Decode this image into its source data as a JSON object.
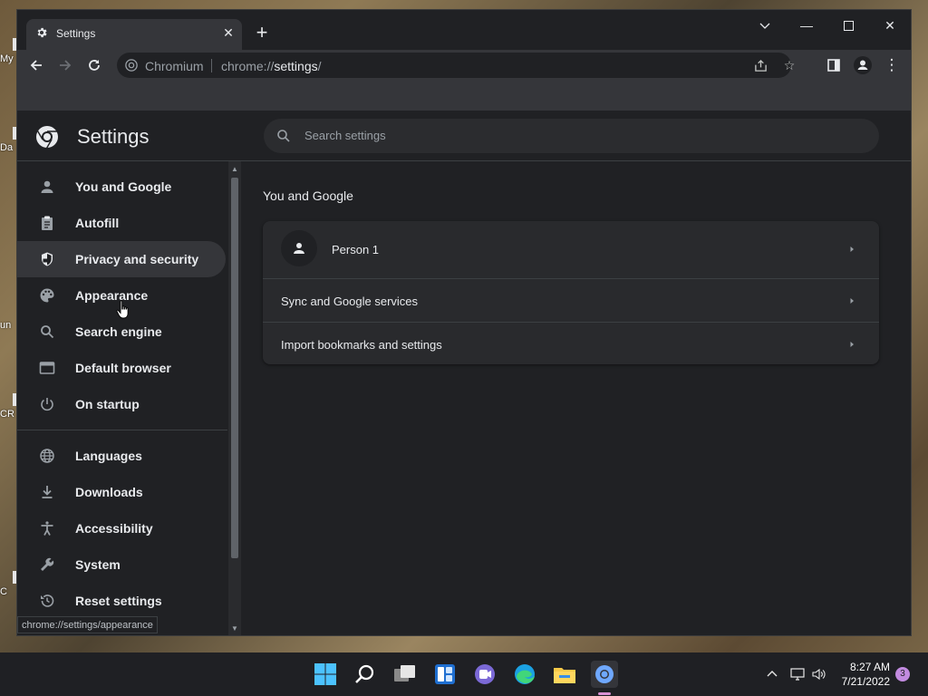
{
  "desktop": {
    "labels": [
      "My",
      "Da",
      "un",
      "CR",
      "C"
    ]
  },
  "browser": {
    "tab": {
      "title": "Settings"
    },
    "omnibox": {
      "site_label": "Chromium",
      "url_scheme": "chrome://",
      "url_path": "settings",
      "url_rest": "/"
    }
  },
  "settings": {
    "title": "Settings",
    "search_placeholder": "Search settings",
    "nav": [
      {
        "label": "You and Google",
        "icon": "person-icon"
      },
      {
        "label": "Autofill",
        "icon": "clipboard-icon"
      },
      {
        "label": "Privacy and security",
        "icon": "shield-icon",
        "active": true
      },
      {
        "label": "Appearance",
        "icon": "palette-icon"
      },
      {
        "label": "Search engine",
        "icon": "search-icon"
      },
      {
        "label": "Default browser",
        "icon": "browser-icon"
      },
      {
        "label": "On startup",
        "icon": "power-icon"
      },
      {
        "label": "Languages",
        "icon": "globe-icon"
      },
      {
        "label": "Downloads",
        "icon": "download-icon"
      },
      {
        "label": "Accessibility",
        "icon": "accessibility-icon"
      },
      {
        "label": "System",
        "icon": "wrench-icon"
      },
      {
        "label": "Reset settings",
        "icon": "restore-icon"
      }
    ],
    "section": {
      "title": "You and Google",
      "rows": [
        {
          "label": "Person 1"
        },
        {
          "label": "Sync and Google services"
        },
        {
          "label": "Import bookmarks and settings"
        }
      ]
    },
    "status_url": "chrome://settings/appearance"
  },
  "taskbar": {
    "clock_time": "8:27 AM",
    "clock_date": "7/21/2022",
    "notification_count": "3"
  },
  "colors": {
    "background": "#202124",
    "active_nav": "#35363a",
    "card": "#292a2d",
    "text": "#e8eaed"
  }
}
